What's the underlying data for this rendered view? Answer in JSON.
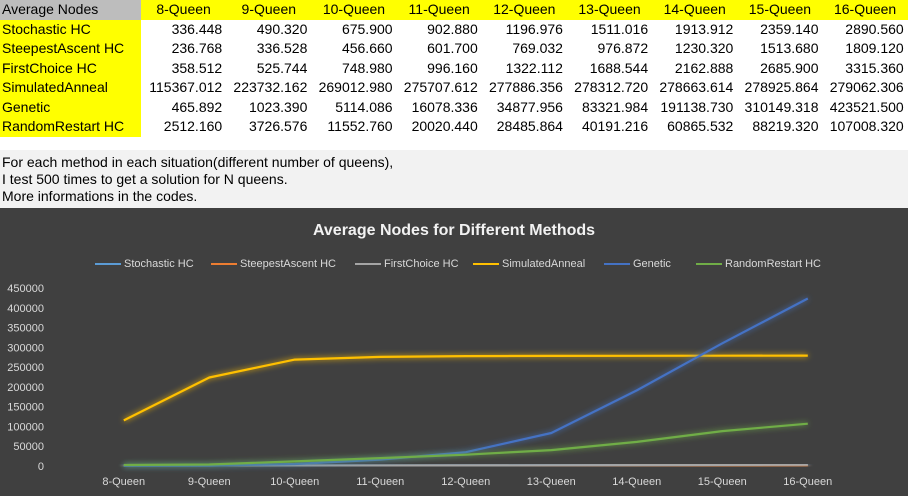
{
  "table": {
    "header": [
      "Average Nodes",
      "8-Queen",
      "9-Queen",
      "10-Queen",
      "11-Queen",
      "12-Queen",
      "13-Queen",
      "14-Queen",
      "15-Queen",
      "16-Queen"
    ],
    "rows": [
      {
        "label": "Stochastic HC",
        "values": [
          "336.448",
          "490.320",
          "675.900",
          "902.880",
          "1196.976",
          "1511.016",
          "1913.912",
          "2359.140",
          "2890.560"
        ]
      },
      {
        "label": "SteepestAscent HC",
        "values": [
          "236.768",
          "336.528",
          "456.660",
          "601.700",
          "769.032",
          "976.872",
          "1230.320",
          "1513.680",
          "1809.120"
        ]
      },
      {
        "label": "FirstChoice HC",
        "values": [
          "358.512",
          "525.744",
          "748.980",
          "996.160",
          "1322.112",
          "1688.544",
          "2162.888",
          "2685.900",
          "3315.360"
        ]
      },
      {
        "label": "SimulatedAnneal",
        "values": [
          "115367.012",
          "223732.162",
          "269012.980",
          "275707.612",
          "277886.356",
          "278312.720",
          "278663.614",
          "278925.864",
          "279062.306"
        ]
      },
      {
        "label": "Genetic",
        "values": [
          "465.892",
          "1023.390",
          "5114.086",
          "16078.336",
          "34877.956",
          "83321.984",
          "191138.730",
          "310149.318",
          "423521.500"
        ]
      },
      {
        "label": "RandomRestart HC",
        "values": [
          "2512.160",
          "3726.576",
          "11552.760",
          "20020.440",
          "28485.864",
          "40191.216",
          "60865.532",
          "88219.320",
          "107008.320"
        ]
      }
    ]
  },
  "note": {
    "lines": [
      "For each method in each situation(different number of queens),",
      "I test 500 times to get a solution for N queens.",
      "More informations in the codes."
    ]
  },
  "chart_data": {
    "type": "line",
    "title": "Average Nodes for Different Methods",
    "categories": [
      "8-Queen",
      "9-Queen",
      "10-Queen",
      "11-Queen",
      "12-Queen",
      "13-Queen",
      "14-Queen",
      "15-Queen",
      "16-Queen"
    ],
    "yticks": [
      "0",
      "50000",
      "100000",
      "150000",
      "200000",
      "250000",
      "300000",
      "350000",
      "400000",
      "450000"
    ],
    "ylim": [
      0,
      450000
    ],
    "legend_position": "top",
    "series": [
      {
        "name": "Stochastic HC",
        "color": "#5b9bd5",
        "values": [
          336.448,
          490.32,
          675.9,
          902.88,
          1196.976,
          1511.016,
          1913.912,
          2359.14,
          2890.56
        ]
      },
      {
        "name": "SteepestAscent HC",
        "color": "#ed7d31",
        "values": [
          236.768,
          336.528,
          456.66,
          601.7,
          769.032,
          976.872,
          1230.32,
          1513.68,
          1809.12
        ]
      },
      {
        "name": "FirstChoice HC",
        "color": "#a5a5a5",
        "values": [
          358.512,
          525.744,
          748.98,
          996.16,
          1322.112,
          1688.544,
          2162.888,
          2685.9,
          3315.36
        ]
      },
      {
        "name": "SimulatedAnneal",
        "color": "#ffc000",
        "values": [
          115367.012,
          223732.162,
          269012.98,
          275707.612,
          277886.356,
          278312.72,
          278663.614,
          278925.864,
          279062.306
        ]
      },
      {
        "name": "Genetic",
        "color": "#4472c4",
        "values": [
          465.892,
          1023.39,
          5114.086,
          16078.336,
          34877.956,
          83321.984,
          191138.73,
          310149.318,
          423521.5
        ]
      },
      {
        "name": "RandomRestart HC",
        "color": "#70ad47",
        "values": [
          2512.16,
          3726.576,
          11552.76,
          20020.44,
          28485.864,
          40191.216,
          60865.532,
          88219.32,
          107008.32
        ]
      }
    ]
  }
}
